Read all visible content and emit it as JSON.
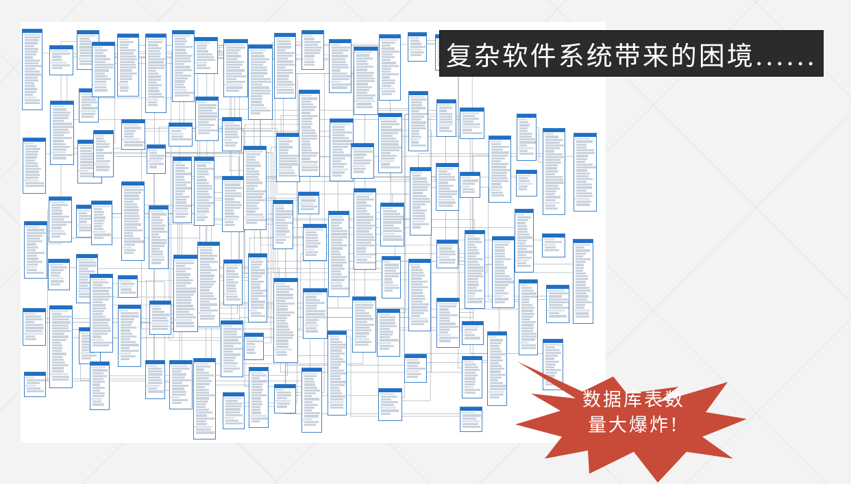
{
  "slide": {
    "title": "复杂软件系统带来的困境......",
    "callout": {
      "line1": "数据库表数",
      "line2": "量大爆炸!"
    }
  },
  "colors": {
    "background": "#f3f3f3",
    "title_box": "#2b2b2b",
    "burst_fill": "#c84a38",
    "table_header": "#1f6fc5",
    "connector": "#9aa4ae"
  }
}
